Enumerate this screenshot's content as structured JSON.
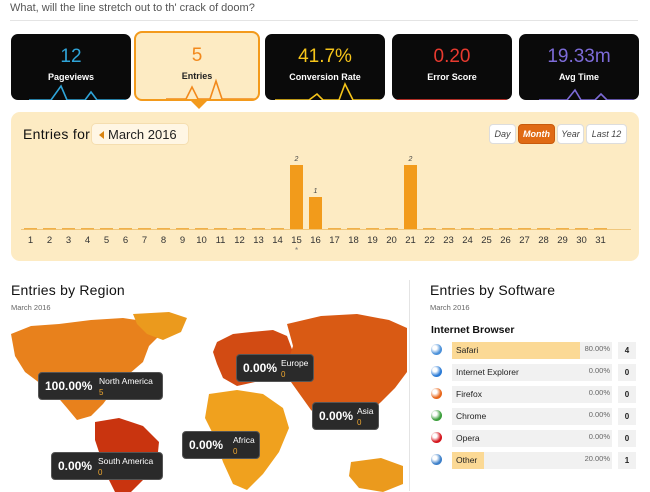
{
  "header": {
    "tagline": "What, will the line stretch out to th' crack of doom?"
  },
  "tiles": [
    {
      "value": "12",
      "label": "Pageviews",
      "color": "#2fa4d8",
      "active": false
    },
    {
      "value": "5",
      "label": "Entries",
      "color": "#f2891c",
      "active": true
    },
    {
      "value": "41.7%",
      "label": "Conversion Rate",
      "color": "#f6c51a",
      "active": false
    },
    {
      "value": "0.20",
      "label": "Error Score",
      "color": "#e83a2f",
      "active": false
    },
    {
      "value": "19.33m",
      "label": "Avg Time",
      "color": "#7d6bd8",
      "active": false
    }
  ],
  "entries_panel": {
    "title_bold": "Entries",
    "title_rest": "for",
    "month": "March 2016",
    "ranges": [
      {
        "label": "Day",
        "active": false
      },
      {
        "label": "Month",
        "active": true
      },
      {
        "label": "Year",
        "active": false
      },
      {
        "label": "Last 12",
        "active": false
      }
    ],
    "marker_char": "*"
  },
  "chart_data": {
    "type": "bar",
    "categories": [
      "1",
      "2",
      "3",
      "4",
      "5",
      "6",
      "7",
      "8",
      "9",
      "10",
      "11",
      "12",
      "13",
      "14",
      "15",
      "16",
      "17",
      "18",
      "19",
      "20",
      "21",
      "22",
      "23",
      "24",
      "25",
      "26",
      "27",
      "28",
      "29",
      "30",
      "31"
    ],
    "values": [
      0,
      0,
      0,
      0,
      0,
      0,
      0,
      0,
      0,
      0,
      0,
      0,
      0,
      0,
      2,
      1,
      0,
      0,
      0,
      0,
      2,
      0,
      0,
      0,
      0,
      0,
      0,
      0,
      0,
      0,
      0
    ],
    "data_labels": [
      "",
      "",
      "",
      "",
      "",
      "",
      "",
      "",
      "",
      "",
      "",
      "",
      "",
      "",
      "2",
      "1",
      "",
      "",
      "",
      "",
      "2",
      "",
      "",
      "",
      "",
      "",
      "",
      "",
      "",
      "",
      ""
    ],
    "bar_color": "#f29b1b",
    "ylim": [
      0,
      2
    ],
    "marker_day": "15"
  },
  "region": {
    "title_bold": "Entries",
    "title_rest": "by Region",
    "subtitle": "March 2016",
    "labels": [
      {
        "pct": "100.00%",
        "name": "North America",
        "count": "5"
      },
      {
        "pct": "0.00%",
        "name": "Europe",
        "count": "0"
      },
      {
        "pct": "0.00%",
        "name": "Asia",
        "count": "0"
      },
      {
        "pct": "0.00%",
        "name": "Africa",
        "count": "0"
      },
      {
        "pct": "0.00%",
        "name": "South America",
        "count": "0"
      }
    ],
    "map_colors": {
      "north_america": "#e8811c",
      "europe": "#d24b13",
      "asia": "#d95a14",
      "africa": "#f0a11e",
      "south_america": "#c9340f",
      "other": "#eb9a1d"
    }
  },
  "software": {
    "title_bold": "Entries",
    "title_rest": "by Software",
    "subtitle": "March 2016",
    "group_title": "Internet Browser",
    "browsers": [
      {
        "name": "Safari",
        "pct": "80.00%",
        "count": "4",
        "fraction": 0.8,
        "icon": "safari-icon",
        "icon_color": "#4a90d9"
      },
      {
        "name": "Internet Explorer",
        "pct": "0.00%",
        "count": "0",
        "fraction": 0,
        "icon": "ie-icon",
        "icon_color": "#2b7bd6"
      },
      {
        "name": "Firefox",
        "pct": "0.00%",
        "count": "0",
        "fraction": 0,
        "icon": "firefox-icon",
        "icon_color": "#e8661a"
      },
      {
        "name": "Chrome",
        "pct": "0.00%",
        "count": "0",
        "fraction": 0,
        "icon": "chrome-icon",
        "icon_color": "#3b9e3b"
      },
      {
        "name": "Opera",
        "pct": "0.00%",
        "count": "0",
        "fraction": 0,
        "icon": "opera-icon",
        "icon_color": "#d4141c"
      },
      {
        "name": "Other",
        "pct": "20.00%",
        "count": "1",
        "fraction": 0.2,
        "icon": "globe-icon",
        "icon_color": "#3c7fc9"
      }
    ]
  }
}
